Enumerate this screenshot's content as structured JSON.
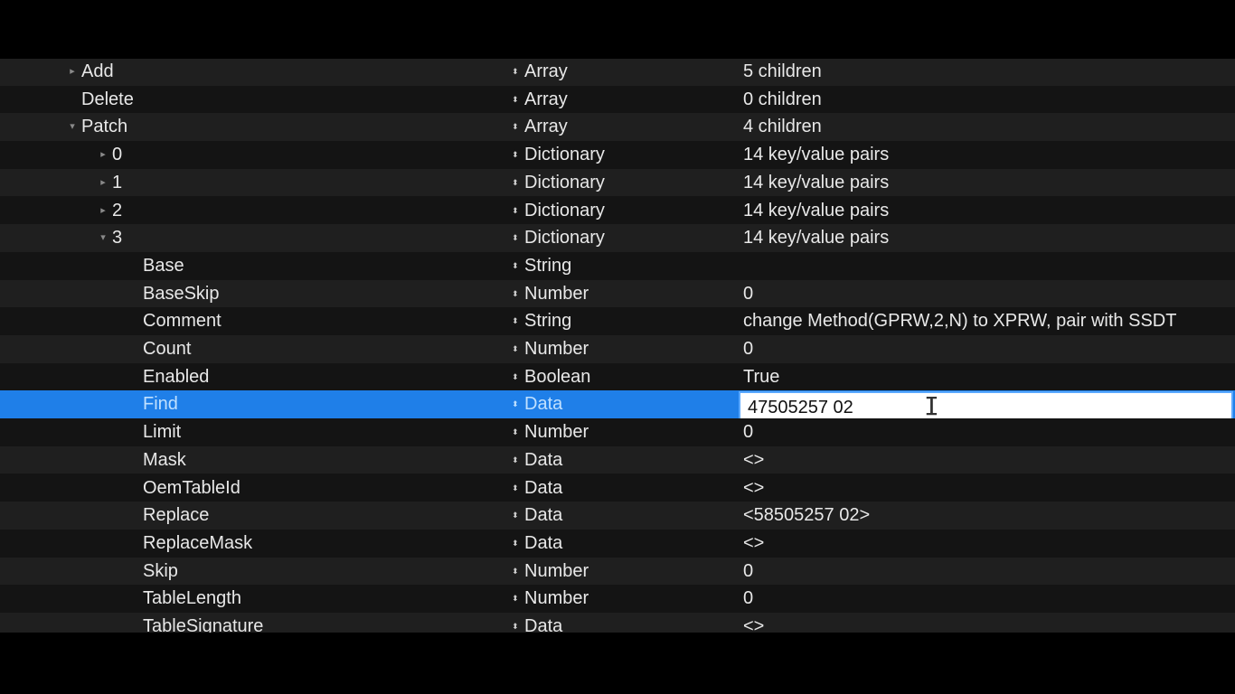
{
  "rows": [
    {
      "key": "Add",
      "type": "Array",
      "value": "5 children",
      "depth": 0,
      "disclosure": "collapsed"
    },
    {
      "key": "Delete",
      "type": "Array",
      "value": "0 children",
      "depth": 0,
      "disclosure": "none"
    },
    {
      "key": "Patch",
      "type": "Array",
      "value": "4 children",
      "depth": 0,
      "disclosure": "expanded"
    },
    {
      "key": "0",
      "type": "Dictionary",
      "value": "14 key/value pairs",
      "depth": 1,
      "disclosure": "collapsed"
    },
    {
      "key": "1",
      "type": "Dictionary",
      "value": "14 key/value pairs",
      "depth": 1,
      "disclosure": "collapsed"
    },
    {
      "key": "2",
      "type": "Dictionary",
      "value": "14 key/value pairs",
      "depth": 1,
      "disclosure": "collapsed"
    },
    {
      "key": "3",
      "type": "Dictionary",
      "value": "14 key/value pairs",
      "depth": 1,
      "disclosure": "expanded"
    },
    {
      "key": "Base",
      "type": "String",
      "value": "",
      "depth": 2,
      "disclosure": "none"
    },
    {
      "key": "BaseSkip",
      "type": "Number",
      "value": "0",
      "depth": 2,
      "disclosure": "none"
    },
    {
      "key": "Comment",
      "type": "String",
      "value": "change Method(GPRW,2,N) to XPRW, pair with SSDT",
      "depth": 2,
      "disclosure": "none"
    },
    {
      "key": "Count",
      "type": "Number",
      "value": "0",
      "depth": 2,
      "disclosure": "none"
    },
    {
      "key": "Enabled",
      "type": "Boolean",
      "value": "True",
      "depth": 2,
      "disclosure": "none"
    },
    {
      "key": "Find",
      "type": "Data",
      "value": "47505257 02",
      "depth": 2,
      "disclosure": "none",
      "selected": true,
      "editing": true
    },
    {
      "key": "Limit",
      "type": "Number",
      "value": "0",
      "depth": 2,
      "disclosure": "none"
    },
    {
      "key": "Mask",
      "type": "Data",
      "value": "<>",
      "depth": 2,
      "disclosure": "none"
    },
    {
      "key": "OemTableId",
      "type": "Data",
      "value": "<>",
      "depth": 2,
      "disclosure": "none"
    },
    {
      "key": "Replace",
      "type": "Data",
      "value": "<58505257 02>",
      "depth": 2,
      "disclosure": "none"
    },
    {
      "key": "ReplaceMask",
      "type": "Data",
      "value": "<>",
      "depth": 2,
      "disclosure": "none"
    },
    {
      "key": "Skip",
      "type": "Number",
      "value": "0",
      "depth": 2,
      "disclosure": "none"
    },
    {
      "key": "TableLength",
      "type": "Number",
      "value": "0",
      "depth": 2,
      "disclosure": "none"
    },
    {
      "key": "TableSignature",
      "type": "Data",
      "value": "<>",
      "depth": 2,
      "disclosure": "none"
    }
  ],
  "icons": {
    "stepper": "up-down-stepper-icon",
    "collapsed": "chevron-right-icon",
    "expanded": "chevron-down-icon",
    "cursor": "text-cursor-icon"
  },
  "colors": {
    "selection": "#1f7fe8",
    "row_dark": "#141414",
    "row_light": "#1f1f1f",
    "text": "#e8e8e8"
  }
}
